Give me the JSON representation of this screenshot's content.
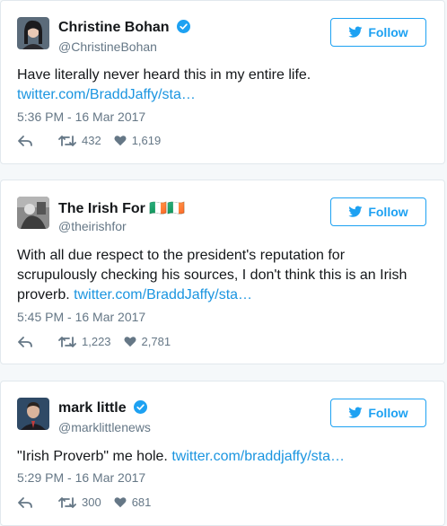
{
  "tweets": [
    {
      "name": "Christine Bohan",
      "verified": true,
      "handle": "@ChristineBohan",
      "follow_label": "Follow",
      "text": "Have literally never heard this in my entire life.",
      "link": "twitter.com/BraddJaffy/sta…",
      "time": "5:36 PM - 16 Mar 2017",
      "retweets": "432",
      "likes": "1,619",
      "avatar": "woman-portrait-avatar"
    },
    {
      "name": "The Irish For 🇮🇪🇮🇪",
      "verified": false,
      "handle": "@theirishfor",
      "follow_label": "Follow",
      "text_line1": "With all due respect to the president's reputation for",
      "text_line2": "scrupulously checking his sources, I don't think this is an Irish",
      "text_line3": "proverb.",
      "link": "twitter.com/BraddJaffy/sta…",
      "time": "5:45 PM - 16 Mar 2017",
      "retweets": "1,223",
      "likes": "2,781",
      "avatar": "grayscale-photo-avatar"
    },
    {
      "name": "mark little",
      "verified": true,
      "handle": "@marklittlenews",
      "follow_label": "Follow",
      "text": "\"Irish Proverb\" me hole.",
      "link": "twitter.com/braddjaffy/sta…",
      "time": "5:29 PM - 16 Mar 2017",
      "retweets": "300",
      "likes": "681",
      "avatar": "man-portrait-avatar"
    }
  ],
  "colors": {
    "accent": "#1da1f2",
    "link": "#1b95e0",
    "muted": "#657786",
    "border": "#e1e8ed"
  }
}
